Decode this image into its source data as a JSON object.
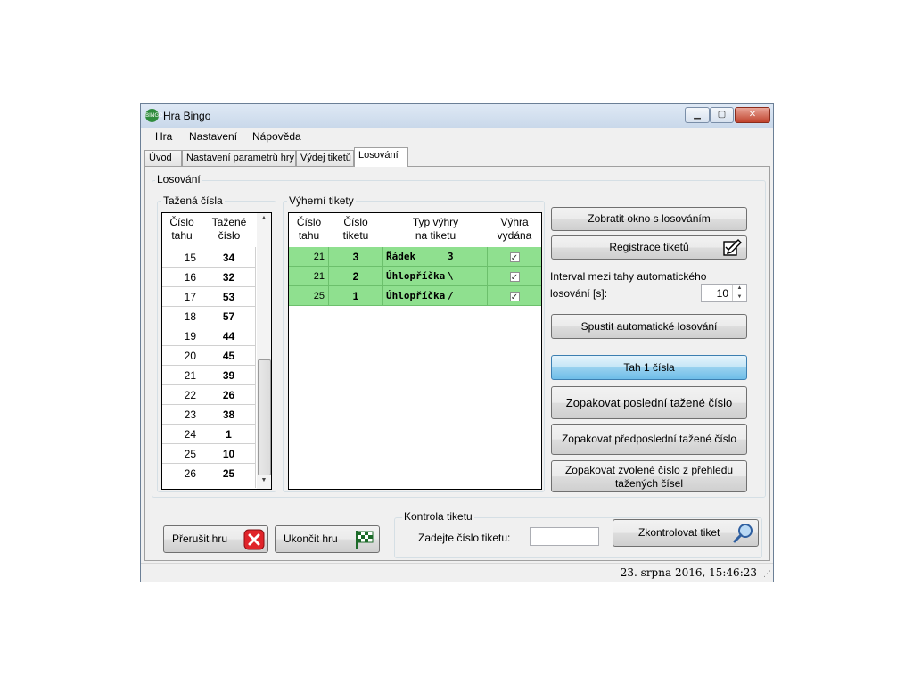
{
  "window": {
    "title": "Hra Bingo",
    "icon_label": "BINGO"
  },
  "menu": [
    "Hra",
    "Nastavení",
    "Nápověda"
  ],
  "tabs": [
    "Úvod",
    "Nastavení parametrů hry",
    "Výdej tiketů",
    "Losování"
  ],
  "active_tab": "Losování",
  "losovani": {
    "group_title": "Losování",
    "drawn": {
      "title": "Tažená čísla",
      "col_draw": [
        "Číslo",
        "tahu"
      ],
      "col_number": [
        "Tažené",
        "číslo"
      ],
      "rows": [
        {
          "draw": "15",
          "number": "34"
        },
        {
          "draw": "16",
          "number": "32"
        },
        {
          "draw": "17",
          "number": "53"
        },
        {
          "draw": "18",
          "number": "57"
        },
        {
          "draw": "19",
          "number": "44"
        },
        {
          "draw": "20",
          "number": "45"
        },
        {
          "draw": "21",
          "number": "39"
        },
        {
          "draw": "22",
          "number": "26"
        },
        {
          "draw": "23",
          "number": "38"
        },
        {
          "draw": "24",
          "number": "1"
        },
        {
          "draw": "25",
          "number": "10"
        },
        {
          "draw": "26",
          "number": "25"
        }
      ]
    },
    "winning": {
      "title": "Výherní tikety",
      "col_draw": [
        "Číslo",
        "tahu"
      ],
      "col_ticket": [
        "Číslo",
        "tiketu"
      ],
      "col_type": [
        "Typ výhry",
        "na tiketu"
      ],
      "col_paid": [
        "Výhra",
        "vydána"
      ],
      "rows": [
        {
          "draw": "21",
          "ticket": "3",
          "type": "Řádek",
          "type_extra": "3",
          "paid": "✓"
        },
        {
          "draw": "21",
          "ticket": "2",
          "type": "Úhlopříčka",
          "type_extra": "\\",
          "paid": "✓"
        },
        {
          "draw": "25",
          "ticket": "1",
          "type": "Úhlopříčka",
          "type_extra": "/",
          "paid": "✓"
        }
      ],
      "row_color": "#8fe08f"
    },
    "buttons": {
      "show_window": "Zobratit okno s losováním",
      "register": "Registrace tiketů",
      "start_auto": "Spustit automatické losování",
      "draw_one": "Tah 1 čísla",
      "repeat_last": "Zopakovat poslední tažené číslo",
      "repeat_prev": "Zopakovat předposlední tažené číslo",
      "repeat_selected_1": "Zopakovat zvolené číslo z přehledu",
      "repeat_selected_2": "tažených čísel"
    },
    "interval_label_1": "Interval mezi tahy automatického",
    "interval_label_2": "losování [s]:",
    "interval_value": "10"
  },
  "bottom": {
    "abort": "Přerušit hru",
    "finish": "Ukončit hru",
    "check_group": "Kontrola tiketu",
    "ticket_label": "Zadejte číslo tiketu:",
    "ticket_value": "",
    "check_button": "Zkontrolovat tiket"
  },
  "status": {
    "datetime": "23. srpna 2016, 15:46:23"
  }
}
